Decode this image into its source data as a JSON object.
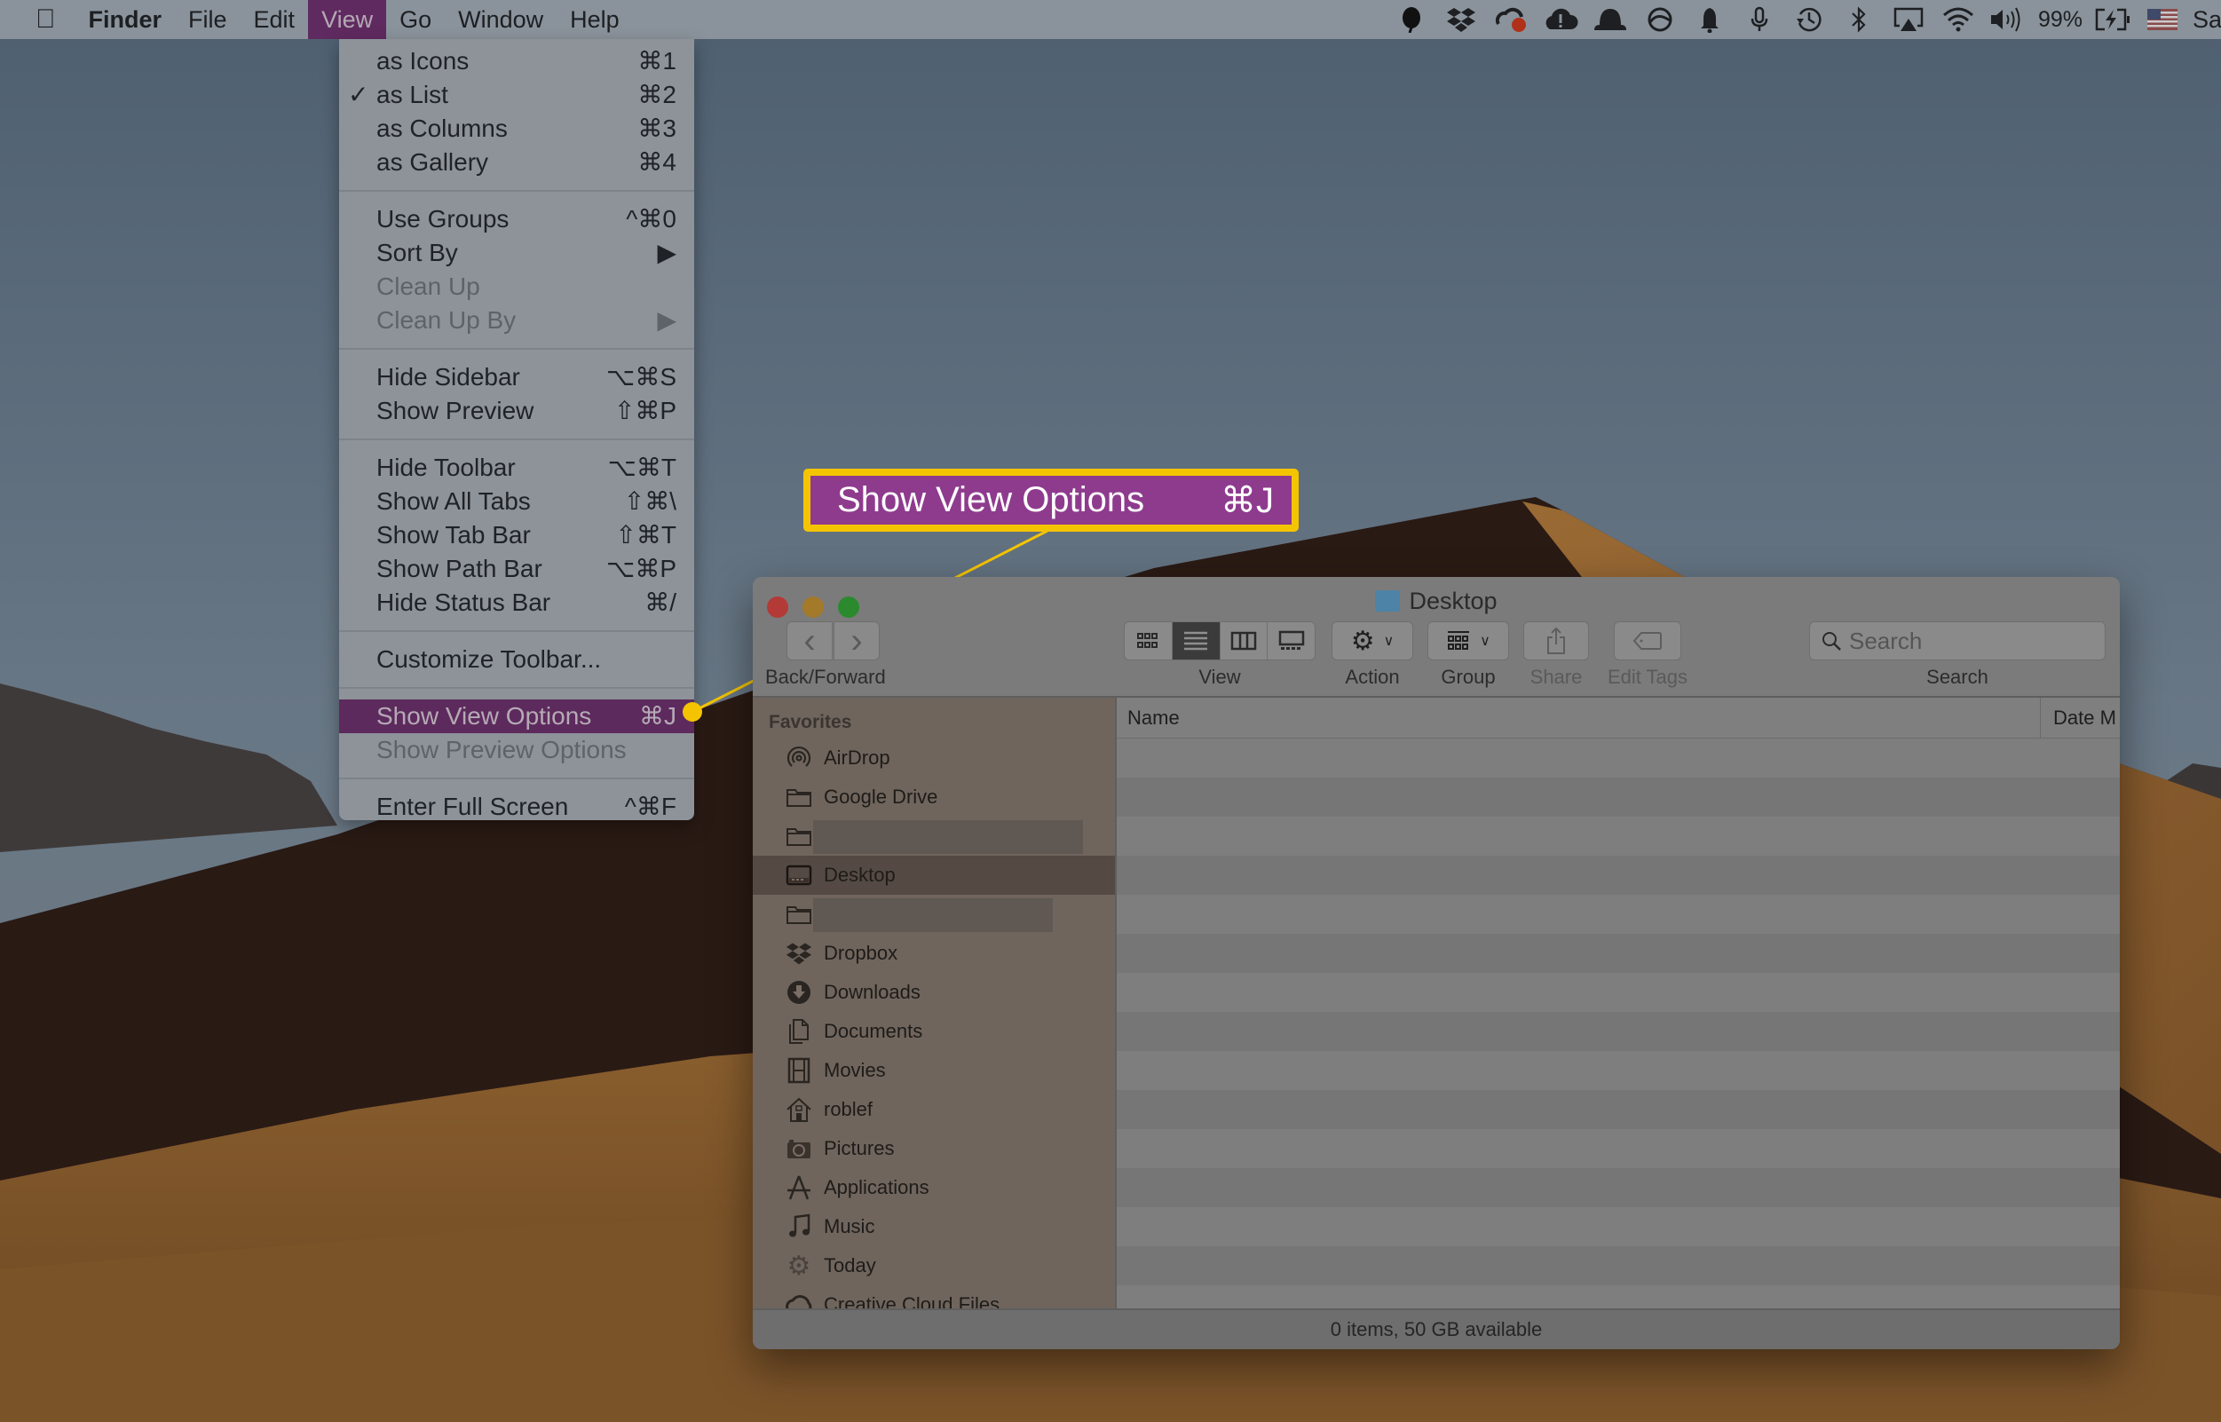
{
  "menubar": {
    "apple": "",
    "app_name": "Finder",
    "items": [
      "File",
      "Edit",
      "View",
      "Go",
      "Window",
      "Help"
    ],
    "active_item": "View",
    "status_icons": [
      "evernote-icon",
      "dropbox-icon",
      "creative-cloud-icon",
      "backup-alert-icon",
      "hat-icon",
      "istat-icon",
      "notification-bell-icon",
      "microphone-icon",
      "time-machine-icon",
      "bluetooth-icon",
      "airplay-icon",
      "wifi-icon",
      "volume-icon"
    ],
    "battery_percent": "99%",
    "input_source": "us-flag-icon",
    "user_text": "Sa"
  },
  "view_menu": {
    "groups": [
      [
        {
          "label": "as Icons",
          "shortcut": "⌘1",
          "checked": false,
          "enabled": true
        },
        {
          "label": "as List",
          "shortcut": "⌘2",
          "checked": true,
          "enabled": true
        },
        {
          "label": "as Columns",
          "shortcut": "⌘3",
          "checked": false,
          "enabled": true
        },
        {
          "label": "as Gallery",
          "shortcut": "⌘4",
          "checked": false,
          "enabled": true
        }
      ],
      [
        {
          "label": "Use Groups",
          "shortcut": "^⌘0",
          "enabled": true
        },
        {
          "label": "Sort By",
          "shortcut": "▶",
          "enabled": true
        },
        {
          "label": "Clean Up",
          "shortcut": "",
          "enabled": false
        },
        {
          "label": "Clean Up By",
          "shortcut": "▶",
          "enabled": false
        }
      ],
      [
        {
          "label": "Hide Sidebar",
          "shortcut": "⌥⌘S",
          "enabled": true
        },
        {
          "label": "Show Preview",
          "shortcut": "⇧⌘P",
          "enabled": true
        }
      ],
      [
        {
          "label": "Hide Toolbar",
          "shortcut": "⌥⌘T",
          "enabled": true
        },
        {
          "label": "Show All Tabs",
          "shortcut": "⇧⌘\\",
          "enabled": true
        },
        {
          "label": "Show Tab Bar",
          "shortcut": "⇧⌘T",
          "enabled": true
        },
        {
          "label": "Show Path Bar",
          "shortcut": "⌥⌘P",
          "enabled": true
        },
        {
          "label": "Hide Status Bar",
          "shortcut": "⌘/",
          "enabled": true
        }
      ],
      [
        {
          "label": "Customize Toolbar...",
          "shortcut": "",
          "enabled": true
        }
      ],
      [
        {
          "label": "Show View Options",
          "shortcut": "⌘J",
          "enabled": true,
          "highlighted": true
        },
        {
          "label": "Show Preview Options",
          "shortcut": "",
          "enabled": false
        }
      ],
      [
        {
          "label": "Enter Full Screen",
          "shortcut": "^⌘F",
          "enabled": true
        }
      ]
    ]
  },
  "callout": {
    "label": "Show View Options",
    "shortcut": "⌘J",
    "border_color": "#f5c400",
    "fill_color": "#8e3b8e"
  },
  "finder": {
    "title": "Desktop",
    "toolbar": {
      "back_forward_label": "Back/Forward",
      "back_glyph": "‹",
      "forward_glyph": "›",
      "view_label": "View",
      "view_modes": [
        "icons",
        "list",
        "columns",
        "gallery"
      ],
      "view_selected": "list",
      "action_label": "Action",
      "group_label": "Group",
      "share_label": "Share",
      "edit_tags_label": "Edit Tags",
      "search_label": "Search",
      "search_placeholder": "Search"
    },
    "sidebar": {
      "section": "Favorites",
      "items": [
        {
          "label": "AirDrop",
          "icon": "airdrop-icon"
        },
        {
          "label": "Google Drive",
          "icon": "folder-icon"
        },
        {
          "label": "",
          "icon": "folder-icon",
          "redacted": true
        },
        {
          "label": "Desktop",
          "icon": "desktop-icon",
          "selected": true
        },
        {
          "label": "",
          "icon": "folder-icon",
          "redacted": true
        },
        {
          "label": "Dropbox",
          "icon": "dropbox-icon"
        },
        {
          "label": "Downloads",
          "icon": "downloads-icon"
        },
        {
          "label": "Documents",
          "icon": "documents-icon"
        },
        {
          "label": "Movies",
          "icon": "movies-icon"
        },
        {
          "label": "roblef",
          "icon": "home-icon"
        },
        {
          "label": "Pictures",
          "icon": "camera-icon"
        },
        {
          "label": "Applications",
          "icon": "applications-icon"
        },
        {
          "label": "Music",
          "icon": "music-icon"
        },
        {
          "label": "Today",
          "icon": "gear-icon"
        },
        {
          "label": "Creative Cloud Files",
          "icon": "creative-cloud-icon"
        }
      ]
    },
    "list": {
      "columns": [
        "Name",
        "Date M"
      ],
      "rows": []
    },
    "status": "0 items, 50 GB available"
  }
}
